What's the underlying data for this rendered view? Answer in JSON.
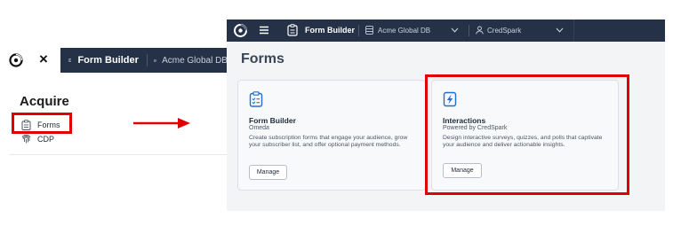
{
  "left_panel": {
    "close_glyph": "×",
    "form_builder_label": "Form Builder",
    "database_label": "Acme Global DB",
    "section_heading": "Acquire",
    "menu": [
      {
        "label": "Forms",
        "icon": "clipboard-icon",
        "highlighted": true
      },
      {
        "label": "CDP",
        "icon": "fingerprint-icon",
        "highlighted": false
      }
    ]
  },
  "navbar": {
    "app_label": "Form Builder",
    "database_label": "Acme Global DB",
    "integration_label": "CredSpark",
    "background": "#243147"
  },
  "page": {
    "title": "Forms",
    "cards": [
      {
        "icon": "clipboard-list-icon",
        "title": "Form Builder",
        "subtitle": "Omeda",
        "description": "Create subscription forms that engage your audience, grow your subscriber list, and offer optional payment methods.",
        "button_label": "Manage"
      },
      {
        "icon": "lightning-bolt-icon",
        "title": "Interactions",
        "subtitle": "Powered by CredSpark",
        "description": "Design interactive surveys, quizzes, and polls that captivate your audience and deliver actionable insights.",
        "button_label": "Manage",
        "highlighted": true
      }
    ]
  },
  "colors": {
    "highlight": "#e00000",
    "accent": "#1f6fd1",
    "navbar": "#243147"
  }
}
